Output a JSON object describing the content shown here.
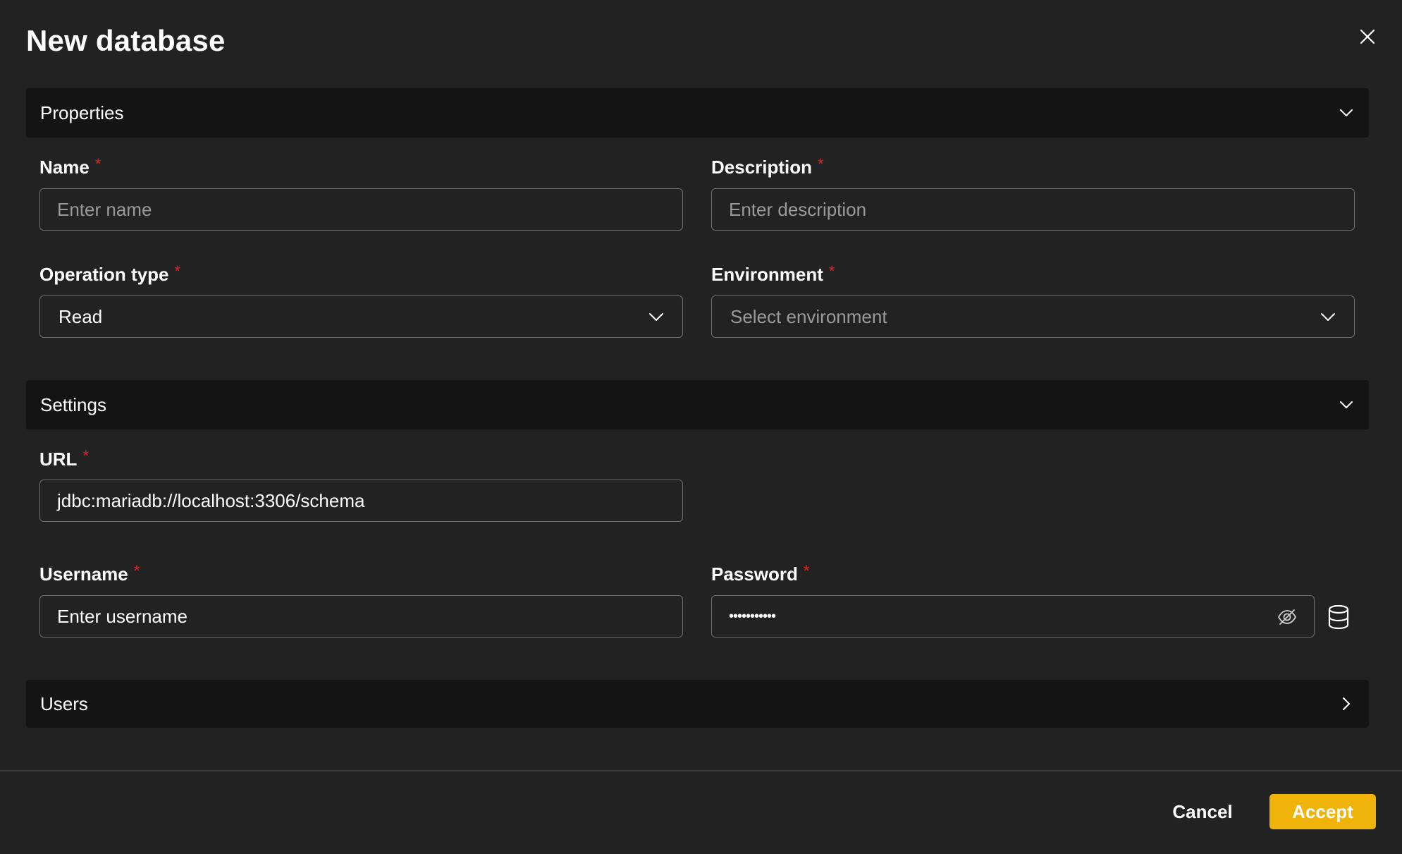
{
  "dialog": {
    "title": "New database",
    "close_icon": "close-icon"
  },
  "sections": {
    "properties": {
      "label": "Properties",
      "state": "expanded"
    },
    "settings": {
      "label": "Settings",
      "state": "expanded"
    },
    "users": {
      "label": "Users",
      "state": "collapsed"
    }
  },
  "fields": {
    "name": {
      "label": "Name",
      "placeholder": "Enter name",
      "value": ""
    },
    "description": {
      "label": "Description",
      "placeholder": "Enter description",
      "value": ""
    },
    "operation_type": {
      "label": "Operation type",
      "value": "Read"
    },
    "environment": {
      "label": "Environment",
      "placeholder": "Select environment",
      "value": ""
    },
    "url": {
      "label": "URL",
      "value": "jdbc:mariadb://localhost:3306/schema"
    },
    "username": {
      "label": "Username",
      "value": "Enter username"
    },
    "password": {
      "label": "Password",
      "masked_value": "•••••••••••"
    }
  },
  "required_marker": "*",
  "footer": {
    "cancel_label": "Cancel",
    "accept_label": "Accept"
  },
  "colors": {
    "background": "#222222",
    "section_header": "#141414",
    "accent": "#f0b30a",
    "required": "#e02424",
    "input_border": "#6e6e6e"
  }
}
